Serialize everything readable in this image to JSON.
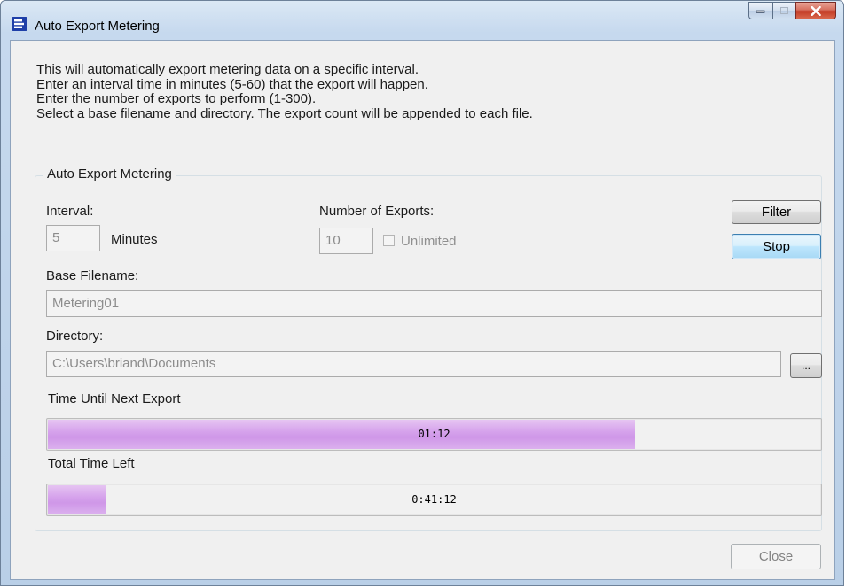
{
  "window": {
    "title": "Auto Export Metering",
    "app_icon": "auto-export-app-icon",
    "caption_buttons": [
      "minimize",
      "maximize",
      "close"
    ]
  },
  "intro": {
    "lines": [
      "This will automatically export metering data on a specific interval.",
      "Enter an interval time in minutes (5-60) that the export will happen.",
      "Enter the number of exports to perform (1-300).",
      "Select a base filename and directory. The export count will be appended to each file."
    ]
  },
  "group": {
    "title": "Auto Export Metering",
    "interval_label": "Interval:",
    "interval_value": "5",
    "minutes_label": "Minutes",
    "exports_label": "Number of Exports:",
    "exports_value": "10",
    "unlimited_label": "Unlimited",
    "unlimited_checked": false,
    "filter_button": "Filter",
    "stop_button": "Stop",
    "filename_label": "Base Filename:",
    "filename_value": "Metering01",
    "directory_label": "Directory:",
    "directory_value": "C:\\Users\\briand\\Documents",
    "browse_button": "...",
    "next_export_label": "Time Until Next Export",
    "next_export_text": "01:12",
    "next_export_progress": 0.76,
    "total_left_label": "Total Time Left",
    "total_left_text": "0:41:12",
    "total_left_progress": 0.075
  },
  "footer": {
    "close_button": "Close"
  },
  "colors": {
    "progress_fill": "#d6a3ec",
    "focus_border": "#3c7fb1",
    "close_caption": "#c33b25"
  }
}
